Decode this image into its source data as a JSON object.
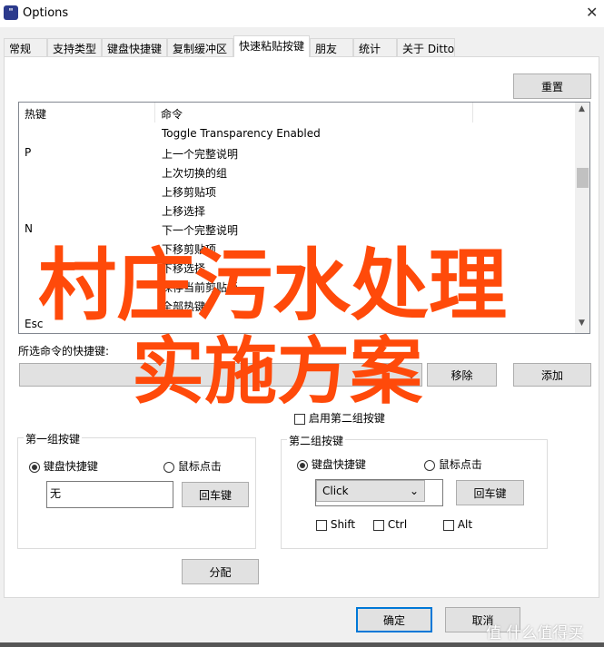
{
  "window": {
    "title": "Options",
    "icon": "ditto-app-icon",
    "close": "✕"
  },
  "tabs": [
    {
      "label": "常规"
    },
    {
      "label": "支持类型"
    },
    {
      "label": "键盘快捷键"
    },
    {
      "label": "复制缓冲区"
    },
    {
      "label": "快速粘贴按键",
      "active": true
    },
    {
      "label": "朋友"
    },
    {
      "label": "统计"
    },
    {
      "label": "关于 Ditto"
    }
  ],
  "reset_label": "重置",
  "list": {
    "headers": [
      "热键",
      "命令"
    ],
    "rows": [
      {
        "key": "",
        "cmd": "Toggle Transparency Enabled"
      },
      {
        "key": "P",
        "cmd": "上一个完整说明"
      },
      {
        "key": "",
        "cmd": "上次切换的组"
      },
      {
        "key": "",
        "cmd": "上移剪贴项"
      },
      {
        "key": "",
        "cmd": "上移选择"
      },
      {
        "key": "N",
        "cmd": "下一个完整说明"
      },
      {
        "key": "",
        "cmd": "下移剪贴项"
      },
      {
        "key": "",
        "cmd": "下移选择"
      },
      {
        "key": "",
        "cmd": "保存当前剪贴板"
      },
      {
        "key": "",
        "cmd": "全部热键"
      },
      {
        "key": "Esc",
        "cmd": ""
      }
    ]
  },
  "selected_shortcut_label": "所选命令的快捷键:",
  "remove_label": "移除",
  "add_label": "添加",
  "enable_second_label": "启用第二组按键",
  "group1": {
    "title": "第一组按键",
    "radio_keyboard": "键盘快捷键",
    "radio_mouse": "鼠标点击",
    "value": "无",
    "enter_label": "回车键"
  },
  "group2": {
    "title": "第二组按键",
    "radio_keyboard": "键盘快捷键",
    "radio_mouse": "鼠标点击",
    "select_value": "Click",
    "enter_label": "回车键",
    "shift": "Shift",
    "ctrl": "Ctrl",
    "alt": "Alt"
  },
  "assign_label": "分配",
  "ok_label": "确定",
  "cancel_label": "取消",
  "overlay": {
    "line1": "村庄污水处理",
    "line2": "实施方案",
    "color": "#ff4a0a"
  },
  "watermark": "值 什么值得买"
}
